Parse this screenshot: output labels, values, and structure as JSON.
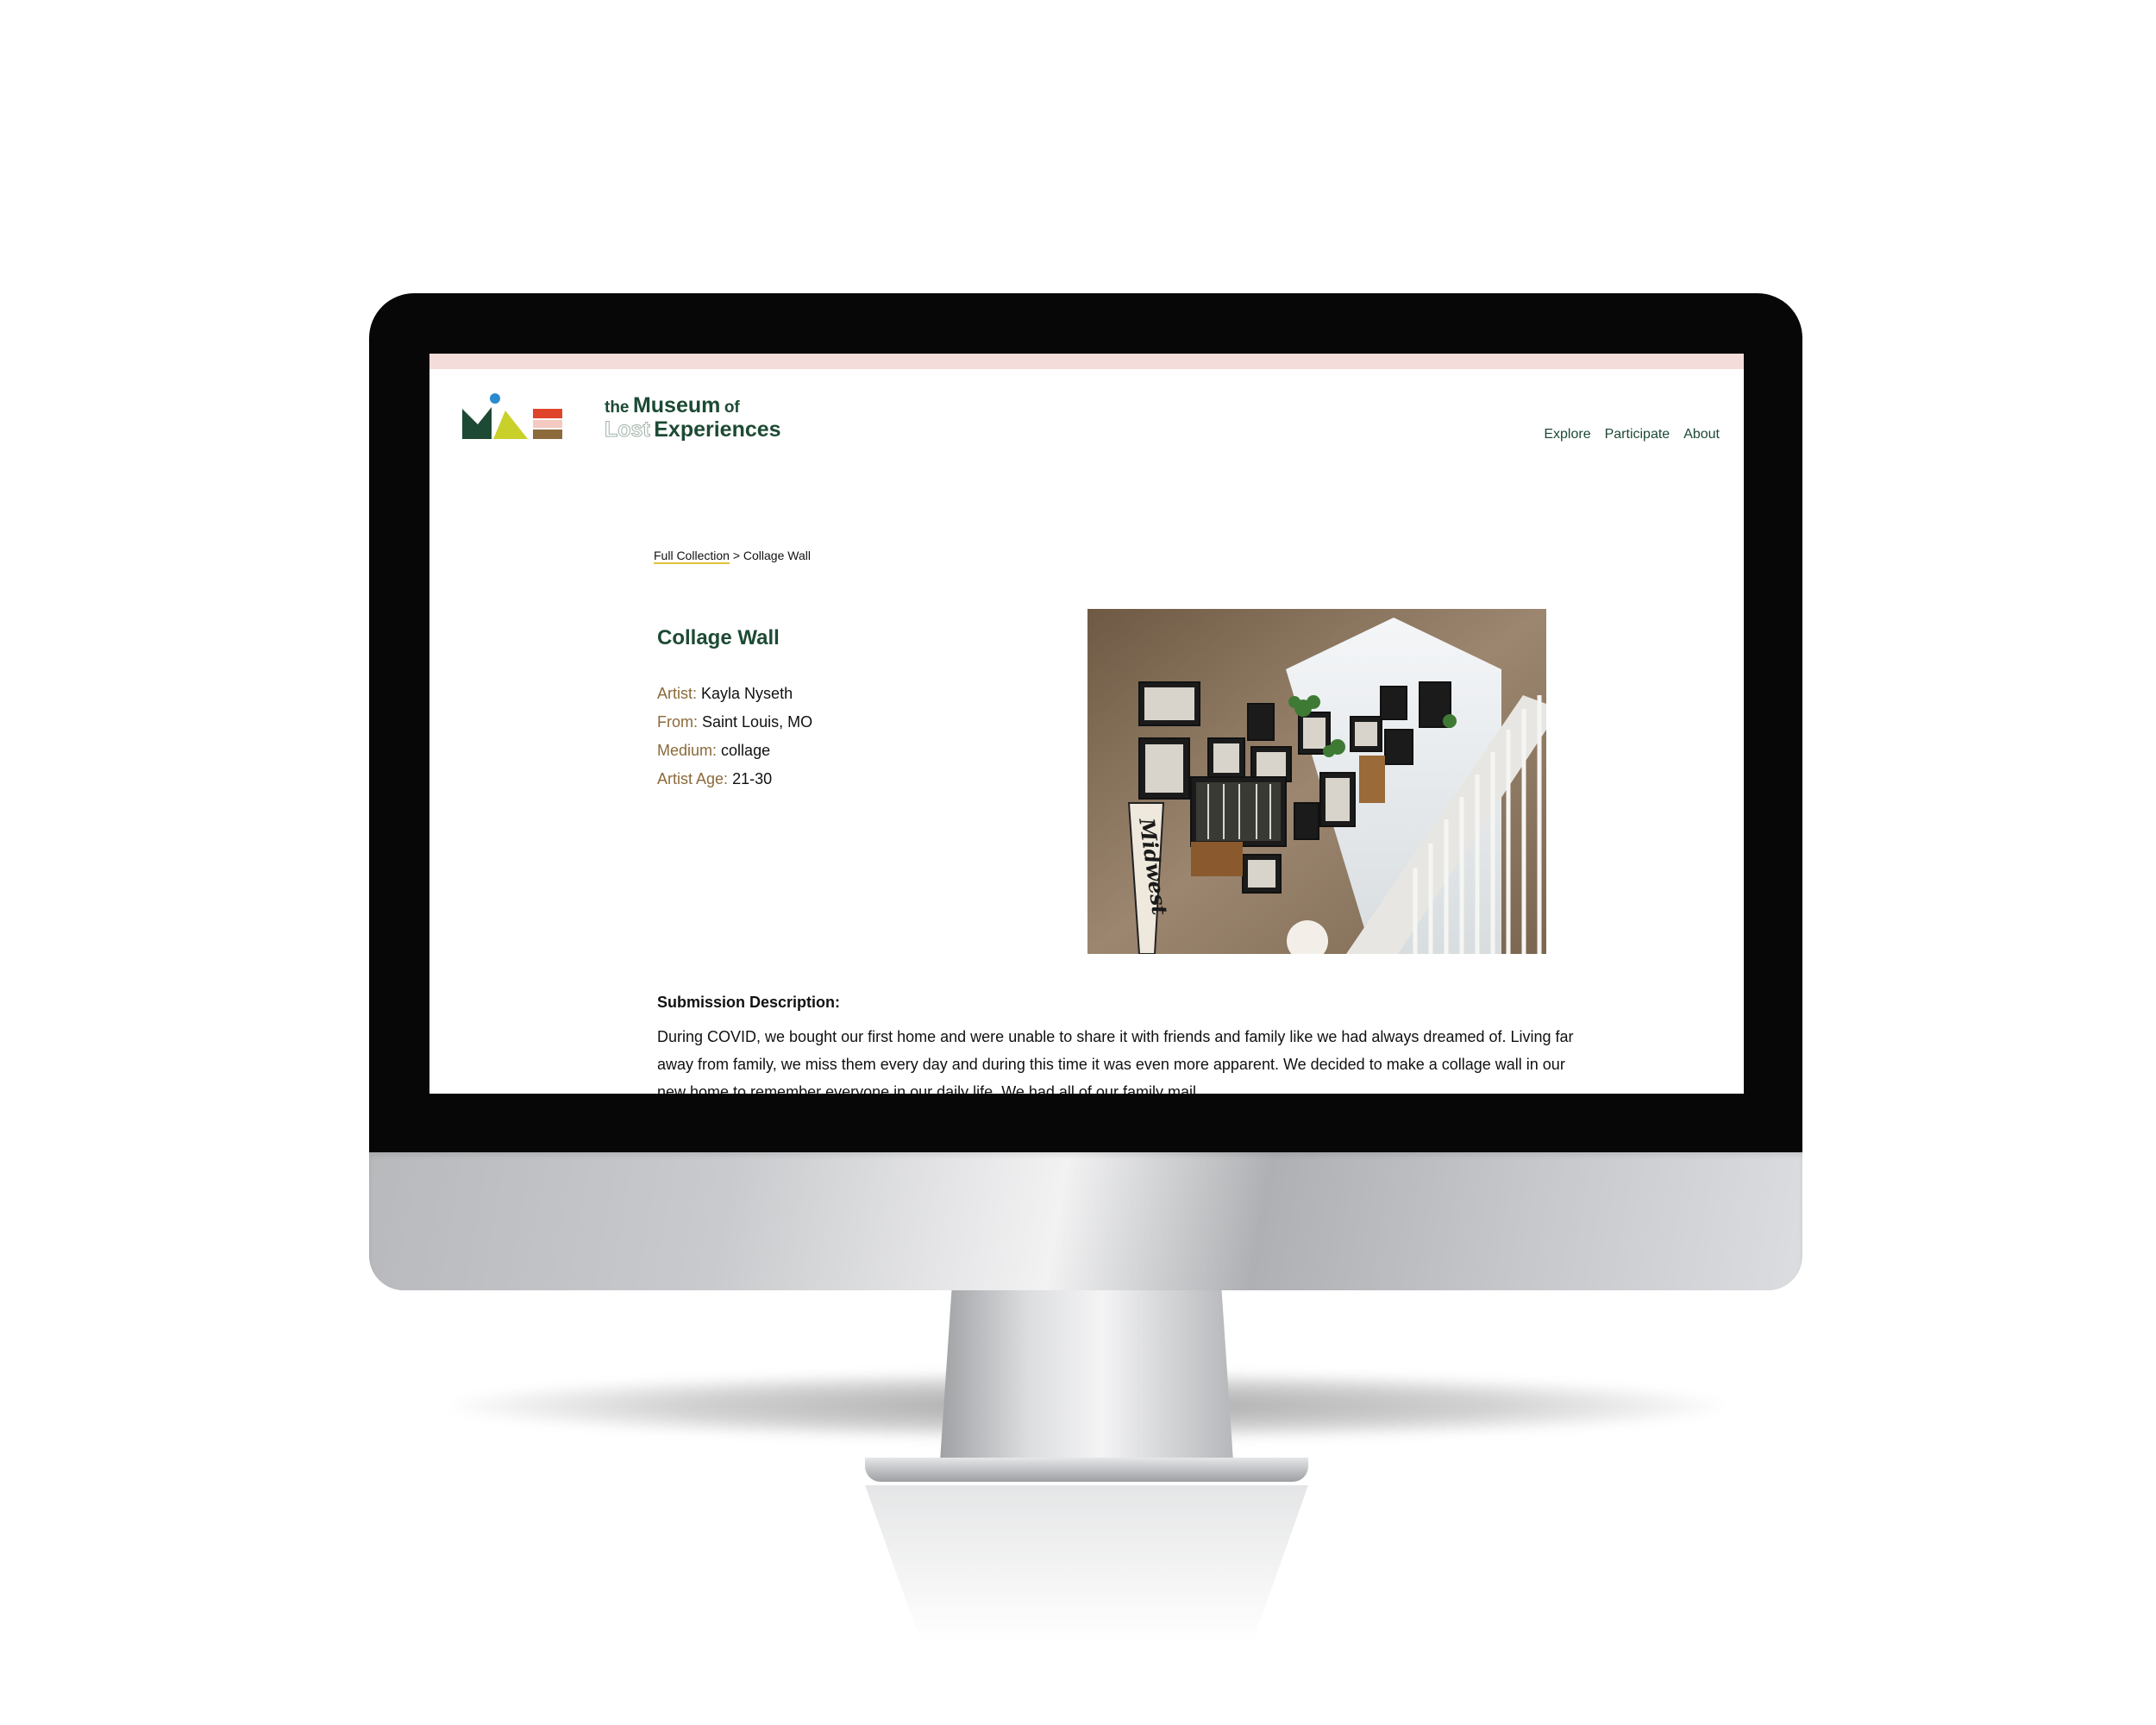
{
  "site": {
    "logo_text_the": "the",
    "logo_text_museum": "Museum",
    "logo_text_of": "of",
    "logo_text_lost": "Lost",
    "logo_text_experiences": "Experiences"
  },
  "nav": {
    "items": [
      {
        "label": "Explore"
      },
      {
        "label": "Participate"
      },
      {
        "label": "About"
      }
    ]
  },
  "breadcrumb": {
    "link": "Full Collection",
    "separator": " > ",
    "current": "Collage Wall"
  },
  "artwork": {
    "title": "Collage Wall",
    "artist_label": "Artist:",
    "artist": "Kayla Nyseth",
    "from_label": "From:",
    "from": "Saint Louis, MO",
    "medium_label": "Medium:",
    "medium": "collage",
    "age_label": "Artist Age:",
    "age": "21-30",
    "pennant_text": "Midwest"
  },
  "description": {
    "heading": "Submission Description:",
    "body": "During COVID, we bought our first home and were unable to share it with friends and family like we had always dreamed of. Living far away from family, we miss them every day and during this time it was even more apparent. We decided to make a collage wall in our new home to remember everyone in our daily life. We had all of our family mail"
  },
  "colors": {
    "brand_green": "#1d4a34",
    "label_brown": "#8a6a3a",
    "top_strip": "#f3dcda",
    "breadcrumb_underline": "#e0c23a"
  }
}
